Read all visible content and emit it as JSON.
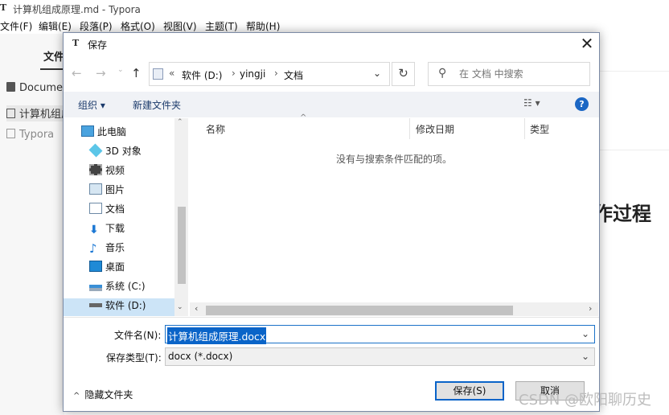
{
  "app": {
    "logo": "T",
    "title": "计算机组成原理.md - Typora",
    "menus": [
      "文件(F)",
      "编辑(E)",
      "段落(P)",
      "格式(O)",
      "视图(V)",
      "主题(T)",
      "帮助(H)"
    ],
    "sidebar_tab": "文件",
    "sidebar_items": [
      "Documents",
      "计算机组成原理.md",
      "Typora"
    ],
    "heading_fragment": "作过程",
    "watermark": "CSDN @欧阳聊历史"
  },
  "dialog": {
    "logo": "T",
    "title": "保存",
    "close_glyph": "✕",
    "nav": {
      "back_glyph": "←",
      "forward_glyph": "→",
      "recent_glyph": "⌄",
      "up_glyph": "↑",
      "crumb_prefix": "«",
      "breadcrumbs": [
        "软件 (D:)",
        "yingji",
        "文档"
      ],
      "crumb_sep": "›",
      "dropdown_glyph": "⌄",
      "refresh_glyph": "↻",
      "search_icon_glyph": "⚲",
      "search_placeholder": "在 文档 中搜索"
    },
    "toolbar": {
      "organize": "组织 ▾",
      "new_folder": "新建文件夹",
      "view_glyph": "☷ ▾",
      "help_glyph": "?"
    },
    "tree": [
      {
        "label": "此电脑",
        "icon": "computer-icon"
      },
      {
        "label": "3D 对象",
        "icon": "3d-objects-icon"
      },
      {
        "label": "视频",
        "icon": "video-icon"
      },
      {
        "label": "图片",
        "icon": "pictures-icon"
      },
      {
        "label": "文档",
        "icon": "documents-icon"
      },
      {
        "label": "下载",
        "icon": "downloads-icon"
      },
      {
        "label": "音乐",
        "icon": "music-icon"
      },
      {
        "label": "桌面",
        "icon": "desktop-icon"
      },
      {
        "label": "系统 (C:)",
        "icon": "drive-c-icon"
      },
      {
        "label": "软件 (D:)",
        "icon": "drive-d-icon"
      }
    ],
    "tree_scroll": {
      "up": "⌃",
      "down": "⌄"
    },
    "columns": [
      "名称",
      "修改日期",
      "类型"
    ],
    "sort_arrow": "^",
    "empty_message": "没有与搜索条件匹配的项。",
    "hscroll": {
      "left": "‹",
      "right": "›"
    },
    "filename_label": "文件名(N):",
    "filename_value": "计算机组成原理.docx",
    "filetype_label": "保存类型(T):",
    "filetype_value": "docx (*.docx)",
    "select_glyph": "⌄",
    "hide_folders_caret": "^",
    "hide_folders": "隐藏文件夹",
    "save_button": "保存(S)",
    "cancel_button": "取消"
  }
}
